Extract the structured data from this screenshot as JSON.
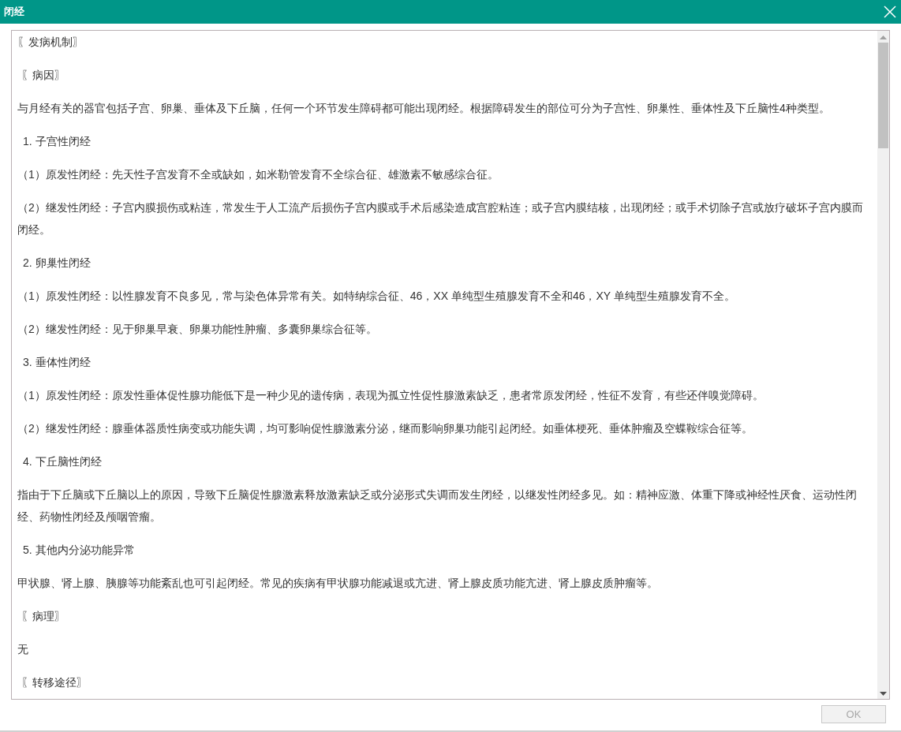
{
  "window": {
    "title": "闭经"
  },
  "content": [
    {
      "kind": "heading",
      "text": "〖发病机制〗"
    },
    {
      "kind": "subheading",
      "text": "〖病因〗"
    },
    {
      "kind": "paragraph",
      "text": "与月经有关的器官包括子宫、卵巢、垂体及下丘脑，任何一个环节发生障碍都可能出现闭经。根据障碍发生的部位可分为子宫性、卵巢性、垂体性及下丘脑性4种类型。"
    },
    {
      "kind": "numbered",
      "text": "1. 子宫性闭经"
    },
    {
      "kind": "paragraph",
      "text": "（1）原发性闭经：先天性子宫发育不全或缺如，如米勒管发育不全综合征、雄激素不敏感综合征。"
    },
    {
      "kind": "paragraph",
      "text": "（2）继发性闭经：子宫内膜损伤或粘连，常发生于人工流产后损伤子宫内膜或手术后感染造成宫腔粘连；或子宫内膜结核，出现闭经；或手术切除子宫或放疗破坏子宫内膜而闭经。"
    },
    {
      "kind": "numbered",
      "text": "2. 卵巢性闭经"
    },
    {
      "kind": "paragraph",
      "text": "（1）原发性闭经：以性腺发育不良多见，常与染色体异常有关。如特纳综合征、46，XX 单纯型生殖腺发育不全和46，XY 单纯型生殖腺发育不全。"
    },
    {
      "kind": "paragraph",
      "text": "（2）继发性闭经：见于卵巢早衰、卵巢功能性肿瘤、多囊卵巢综合征等。"
    },
    {
      "kind": "numbered",
      "text": "3. 垂体性闭经"
    },
    {
      "kind": "paragraph",
      "text": "（1）原发性闭经：原发性垂体促性腺功能低下是一种少见的遗传病，表现为孤立性促性腺激素缺乏，患者常原发闭经，性征不发育，有些还伴嗅觉障碍。"
    },
    {
      "kind": "paragraph",
      "text": "（2）继发性闭经：腺垂体器质性病变或功能失调，均可影响促性腺激素分泌，继而影响卵巢功能引起闭经。如垂体梗死、垂体肿瘤及空蝶鞍综合征等。"
    },
    {
      "kind": "numbered",
      "text": "4. 下丘脑性闭经"
    },
    {
      "kind": "paragraph",
      "text": "指由于下丘脑或下丘脑以上的原因，导致下丘脑促性腺激素释放激素缺乏或分泌形式失调而发生闭经，以继发性闭经多见。如：精神应激、体重下降或神经性厌食、运动性闭经、药物性闭经及颅咽管瘤。"
    },
    {
      "kind": "numbered",
      "text": "5. 其他内分泌功能异常"
    },
    {
      "kind": "paragraph",
      "text": "甲状腺、肾上腺、胰腺等功能紊乱也可引起闭经。常见的疾病有甲状腺功能减退或亢进、肾上腺皮质功能亢进、肾上腺皮质肿瘤等。"
    },
    {
      "kind": "subheading",
      "text": "〖病理〗"
    },
    {
      "kind": "paragraph",
      "text": "无"
    },
    {
      "kind": "subheading",
      "text": "〖转移途径〗"
    }
  ],
  "ok_button": {
    "label": "OK",
    "disabled": true
  }
}
